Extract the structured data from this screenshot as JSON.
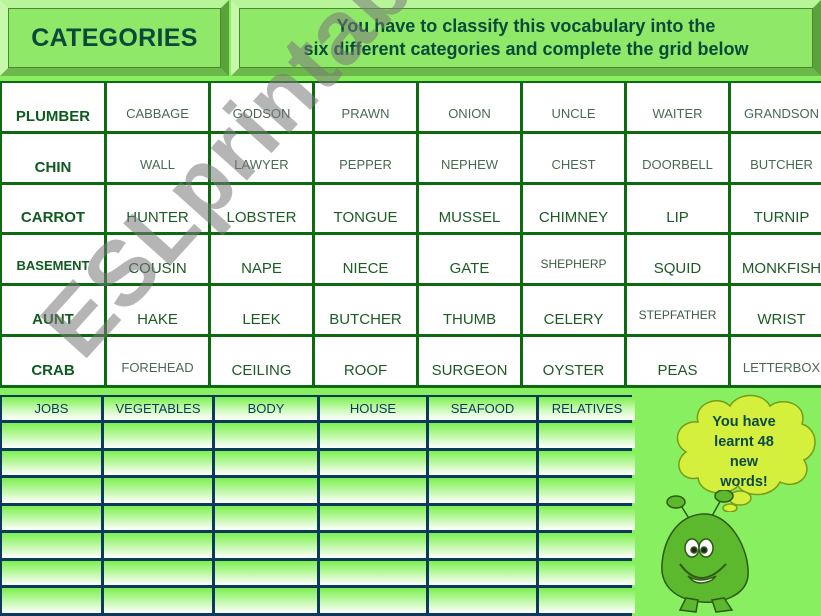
{
  "header": {
    "title": "CATEGORIES",
    "instructions_line1": "You have to classify this vocabulary into the",
    "instructions_line2": "six different categories and complete the grid below"
  },
  "vocabulary": {
    "rows": [
      [
        "PLUMBER",
        "CABBAGE",
        "GODSON",
        "PRAWN",
        "ONION",
        "UNCLE",
        "WAITER",
        "GRANDSON"
      ],
      [
        "CHIN",
        "WALL",
        "LAWYER",
        "PEPPER",
        "NEPHEW",
        "CHEST",
        "DOORBELL",
        "BUTCHER"
      ],
      [
        "CARROT",
        "HUNTER",
        "LOBSTER",
        "TONGUE",
        "MUSSEL",
        "CHIMNEY",
        "LIP",
        "TURNIP"
      ],
      [
        "BASEMENT",
        "COUSIN",
        "NAPE",
        "NIECE",
        "GATE",
        "SHEPHERP",
        "SQUID",
        "MONKFISH"
      ],
      [
        "AUNT",
        "HAKE",
        "LEEK",
        "BUTCHER",
        "THUMB",
        "CELERY",
        "STEPFATHER",
        "WRIST"
      ],
      [
        "CRAB",
        "FOREHEAD",
        "CEILING",
        "ROOF",
        "SURGEON",
        "OYSTER",
        "PEAS",
        "LETTERBOX"
      ]
    ]
  },
  "answer_table": {
    "headers": [
      "JOBS",
      "VEGETABLES",
      "BODY",
      "HOUSE",
      "SEAFOOD",
      "RELATIVES"
    ],
    "empty_rows": 7
  },
  "cloud": {
    "line1": "You have",
    "line2": "learnt 48",
    "line3": "new",
    "line4": "words!"
  },
  "watermark": "ESLprintables.com",
  "colors": {
    "background": "#88f060",
    "grid_border": "#0d6a10",
    "table_border": "#0c3a5a",
    "text_dark": "#0b4a3a",
    "cloud_fill": "#d8f040"
  }
}
